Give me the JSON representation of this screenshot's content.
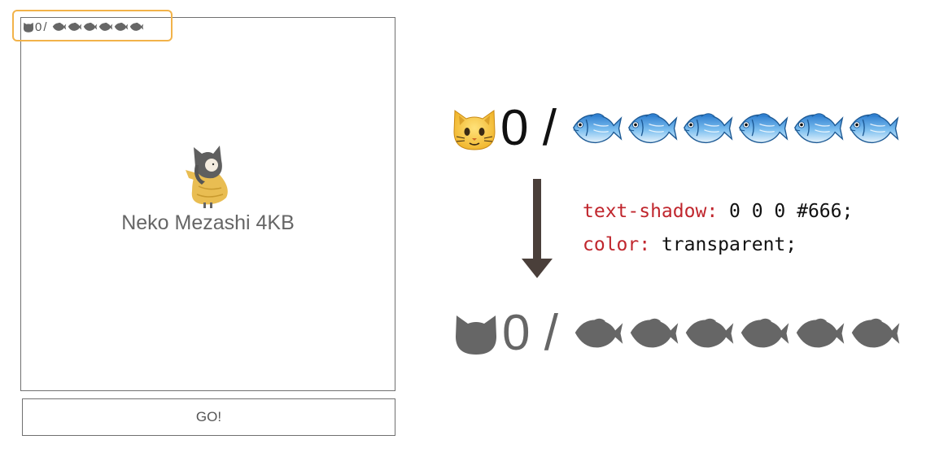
{
  "game": {
    "hud": {
      "score": "0",
      "separator": "/",
      "fish_count": 6
    },
    "title": "Neko Mezashi 4KB",
    "go_button_label": "GO!"
  },
  "explanation": {
    "before": {
      "score": "0",
      "separator": "/",
      "fish_count": 6,
      "style": "color emoji"
    },
    "after": {
      "score": "0",
      "separator": "/",
      "fish_count": 6,
      "style": "gray silhouette"
    },
    "code": [
      {
        "property": "text-shadow:",
        "value": " 0 0 0 #666;"
      },
      {
        "property": "color:",
        "value": " transparent;"
      }
    ]
  },
  "colors": {
    "highlight_border": "#f2b34a",
    "silhouette": "#666666",
    "code_property": "#c0262d",
    "arrow": "#4a3f3a",
    "cat_yellow": "#f5c23a",
    "fish_blue": "#5fa8e0"
  },
  "icons": [
    "cat-face-icon",
    "fish-icon",
    "cat-silhouette-icon",
    "fish-silhouette-icon",
    "down-arrow-icon"
  ]
}
